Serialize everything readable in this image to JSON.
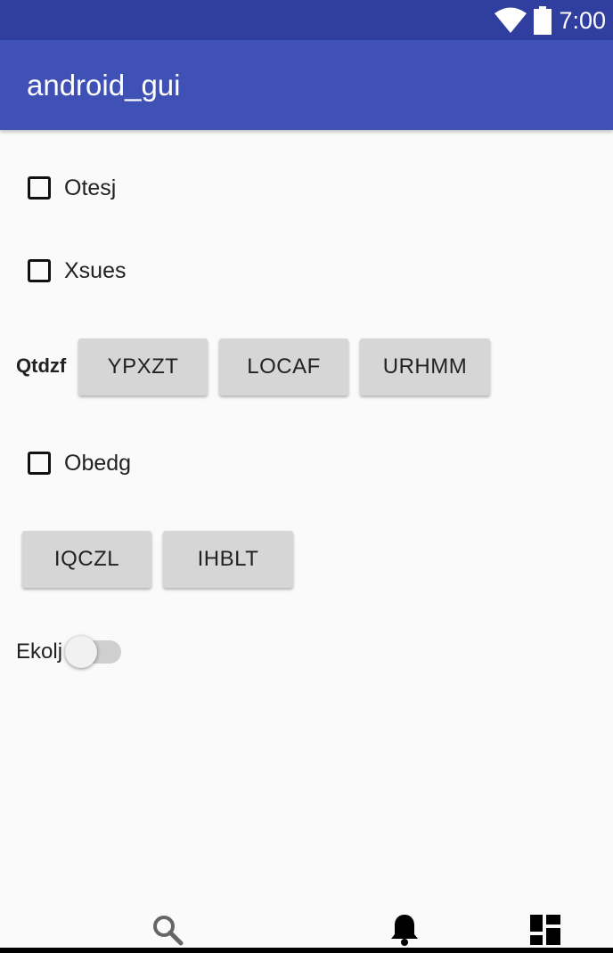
{
  "status_bar": {
    "time": "7:00",
    "icons": [
      "wifi-icon",
      "battery-icon"
    ],
    "color": "#303f9f"
  },
  "app_bar": {
    "title": "android_gui",
    "color": "#3f51b5"
  },
  "checkboxes": [
    {
      "label": "Otesj",
      "checked": false
    },
    {
      "label": "Xsues",
      "checked": false
    },
    {
      "label": "Obedg",
      "checked": false
    }
  ],
  "button_row_1": {
    "label": "Qtdzf",
    "buttons": [
      "YPXZT",
      "LOCAF",
      "URHMM"
    ]
  },
  "button_row_2": {
    "buttons": [
      "IQCZL",
      "IHBLT"
    ]
  },
  "switch": {
    "label": "Ekolj",
    "on": false
  },
  "bottom_nav": {
    "icons": [
      "search-icon",
      "notification-bell-icon",
      "dashboard-icon"
    ]
  }
}
